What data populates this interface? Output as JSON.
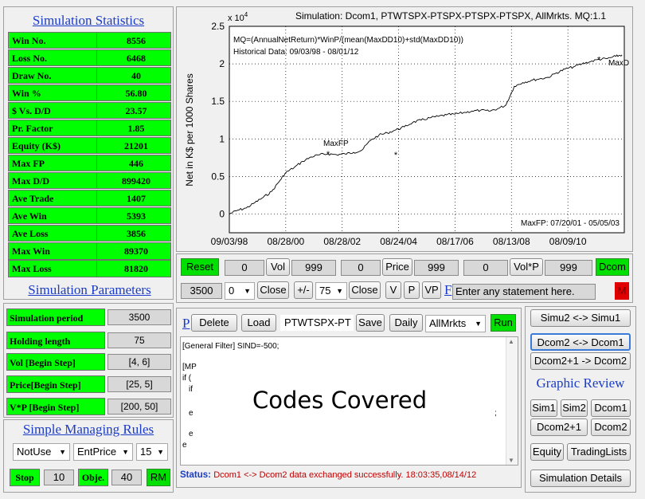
{
  "stats": {
    "title": "Simulation Statistics",
    "rows": [
      {
        "label": "Win No.",
        "value": "8556"
      },
      {
        "label": "Loss No.",
        "value": "6468"
      },
      {
        "label": "Draw No.",
        "value": "40"
      },
      {
        "label": "Win %",
        "value": "56.80"
      },
      {
        "label": "$ Vs. D/D",
        "value": "23.57"
      },
      {
        "label": "Pr. Factor",
        "value": "1.85"
      },
      {
        "label": "Equity (K$)",
        "value": "21201"
      },
      {
        "label": "Max FP",
        "value": "446"
      },
      {
        "label": "Max D/D",
        "value": "899420"
      },
      {
        "label": "Ave Trade",
        "value": "1407"
      },
      {
        "label": "Ave Win",
        "value": "5393"
      },
      {
        "label": "Ave Loss",
        "value": "3856"
      },
      {
        "label": "Max Win",
        "value": "89370"
      },
      {
        "label": "Max Loss",
        "value": "81820"
      }
    ]
  },
  "params": {
    "title": "Simulation Parameters",
    "rows": [
      {
        "label": "Simulation period",
        "value": "3500"
      },
      {
        "label": "Holding length",
        "value": "75"
      },
      {
        "label": "Vol [Begin Step]",
        "value": "[4, 6]"
      },
      {
        "label": "Price[Begin Step]",
        "value": "[25, 5]"
      },
      {
        "label": "V*P [Begin Step]",
        "value": "[200, 50]"
      }
    ]
  },
  "rules": {
    "title": "Simple Managing Rules",
    "sel1": "NotUse",
    "sel2": "EntPrice",
    "sel3": "15",
    "stop_label": "Stop",
    "stop_value": "10",
    "obje_label": "Obje.",
    "obje_value": "40",
    "rm_label": "RM"
  },
  "chart_data": {
    "type": "line",
    "title": "Simulation: Dcom1, PTWTSPX-PTSPX-PTSPX-PTSPX, AllMrkts. MQ:1.1",
    "ylabel": "Net in K$ per 1000 Shares",
    "y_exponent": "x 10",
    "y_exponent_power": "4",
    "ylim": [
      -0.25,
      2.5
    ],
    "yticks": [
      "-0.5",
      "0",
      "0.5",
      "1",
      "1.5",
      "2",
      "2.5"
    ],
    "xticks": [
      "09/03/98",
      "08/28/00",
      "08/28/02",
      "08/24/04",
      "08/17/06",
      "08/13/08",
      "08/09/10"
    ],
    "annotation1": "MQ=(AnnualNetReturn)*WinP/(mean(MaxDD10)+std(MaxDD10))",
    "annotation2": "Historical Data: 09/03/98 - 08/01/12",
    "maxfp_label": "MaxFP",
    "maxd_label": "MaxD",
    "maxfp_note": "MaxFP: 07/20/01 - 05/05/03",
    "series": [
      {
        "x": [
          0,
          0.3,
          0.6,
          0.9,
          1.2,
          1.5,
          1.8,
          2.0,
          2.3,
          2.6,
          2.9,
          3.2,
          3.5,
          3.8,
          4.1,
          4.4,
          4.7,
          5.0,
          5.3,
          5.6,
          5.9,
          6.2,
          6.5,
          6.8,
          7.1,
          7.4,
          7.7,
          8.0,
          8.3,
          8.6,
          8.9,
          9.2,
          9.5,
          9.8,
          10.1,
          10.4,
          10.7,
          11.0,
          11.3,
          11.6,
          11.9,
          12.2,
          12.5,
          12.8,
          13.1,
          13.4,
          13.7,
          13.92
        ],
        "y": [
          0,
          0.05,
          0.08,
          0.15,
          0.22,
          0.3,
          0.45,
          0.55,
          0.62,
          0.7,
          0.76,
          0.79,
          0.8,
          0.79,
          0.8,
          0.82,
          0.85,
          0.98,
          1.05,
          1.08,
          1.12,
          1.16,
          1.22,
          1.25,
          1.28,
          1.3,
          1.32,
          1.33,
          1.35,
          1.37,
          1.38,
          1.37,
          1.4,
          1.45,
          1.7,
          1.75,
          1.78,
          1.8,
          1.82,
          1.88,
          1.93,
          1.96,
          2.0,
          2.03,
          2.06,
          2.07,
          2.1,
          2.12
        ]
      }
    ]
  },
  "controls": {
    "reset": "Reset",
    "v1": "0",
    "vol": "Vol",
    "v2": "999",
    "v3": "0",
    "price": "Price",
    "v4": "999",
    "v5": "0",
    "volp": "Vol*P",
    "v6": "999",
    "dcom": "Dcom",
    "r2_value": "3500",
    "r2_sel1": "0",
    "close1": "Close",
    "pm": "+/-",
    "r2_sel2": "75",
    "close2": "Close",
    "bv": "V",
    "bp": "P",
    "bvp": "VP",
    "f_link": "F",
    "statement_placeholder": "Enter any statement here.",
    "m_btn": "M"
  },
  "code": {
    "p_link": "P",
    "delete": "Delete",
    "load": "Load",
    "file_value": "PTWTSPX-PT",
    "save": "Save",
    "daily": "Daily",
    "market": "AllMrkts",
    "run": "Run",
    "line1": "[General Filter]  SIND=-500;",
    "line2": "[MP",
    "line3": "if (",
    "line4": "if",
    "line5": "e",
    "line6": ";",
    "line7": "e",
    "line8": "e",
    "line9": "end",
    "covered": "Codes Covered",
    "status_label": "Status:",
    "status_text": "Dcom1 <-> Dcom2 data exchanged successfully. 18:03:35,08/14/12"
  },
  "right": {
    "simu": "Simu2 <-> Simu1",
    "dcom21": "Dcom2 <-> Dcom1",
    "dcom2p1": "Dcom2+1 -> Dcom2",
    "graphic_title": "Graphic Review",
    "sim1": "Sim1",
    "sim2": "Sim2",
    "dcom1": "Dcom1",
    "dcom2p1b": "Dcom2+1",
    "dcom2": "Dcom2",
    "equity": "Equity",
    "trading": "TradingLists",
    "details": "Simulation Details"
  }
}
